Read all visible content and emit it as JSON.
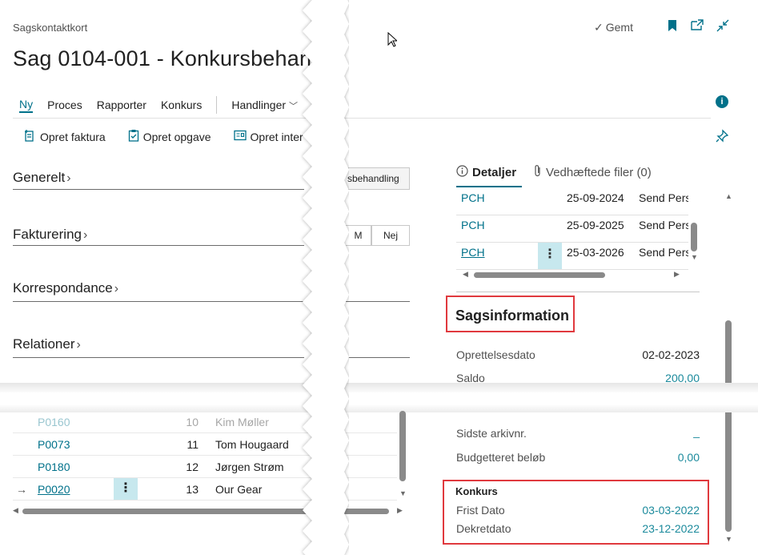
{
  "header": {
    "page_type": "Sagskontaktkort",
    "title": "Sag 0104-001 - Konkursbehan",
    "saved": "Gemt"
  },
  "menu": {
    "items": [
      "Ny",
      "Proces",
      "Rapporter",
      "Konkurs"
    ],
    "actions_menu": "Handlinger"
  },
  "actions": {
    "invoice": "Opret faktura",
    "task": "Opret opgave",
    "internal": "Opret inter"
  },
  "fasttabs": {
    "general": "Generelt",
    "invoicing": "Fakturering",
    "correspondence": "Korrespondance",
    "relations": "Relationer"
  },
  "middle": {
    "tag": "sbehandling",
    "cell_m": "M",
    "cell_no": "Nej"
  },
  "factbox": {
    "tab_details": "Detaljer",
    "tab_attachments": "Vedhæftede filer (0)",
    "rows": [
      {
        "code": "PCH",
        "date": "25-09-2024",
        "action": "Send Pers"
      },
      {
        "code": "PCH",
        "date": "25-09-2025",
        "action": "Send Pers"
      },
      {
        "code": "PCH",
        "date": "25-03-2026",
        "action": "Send Pers"
      }
    ],
    "case_info_title": "Sagsinformation",
    "created_label": "Oprettelsesdato",
    "created_value": "02-02-2023",
    "balance_label": "Saldo",
    "balance_value": "200,00",
    "archive_label": "Sidste arkivnr.",
    "archive_value": "_",
    "budget_label": "Budgetteret beløb",
    "budget_value": "0,00",
    "bankruptcy_title": "Konkurs",
    "deadline_label": "Frist Dato",
    "deadline_value": "03-03-2022",
    "decree_label": "Dekretdato",
    "decree_value": "23-12-2022"
  },
  "list": {
    "rows": [
      {
        "code": "P0160",
        "num": "10",
        "name": "Kim Møller"
      },
      {
        "code": "P0073",
        "num": "11",
        "name": "Tom Hougaard"
      },
      {
        "code": "P0180",
        "num": "12",
        "name": "Jørgen Strøm"
      },
      {
        "code": "P0020",
        "num": "13",
        "name": "Our Gear"
      }
    ]
  },
  "icons": {
    "bookmark": "bookmark-icon",
    "open_new": "open-new-window-icon",
    "collapse": "collapse-icon",
    "info": "info-icon",
    "pin": "pin-icon"
  },
  "colors": {
    "accent": "#00718a",
    "highlight_box": "#e0393e",
    "selected_cell": "#c7e8ee"
  }
}
